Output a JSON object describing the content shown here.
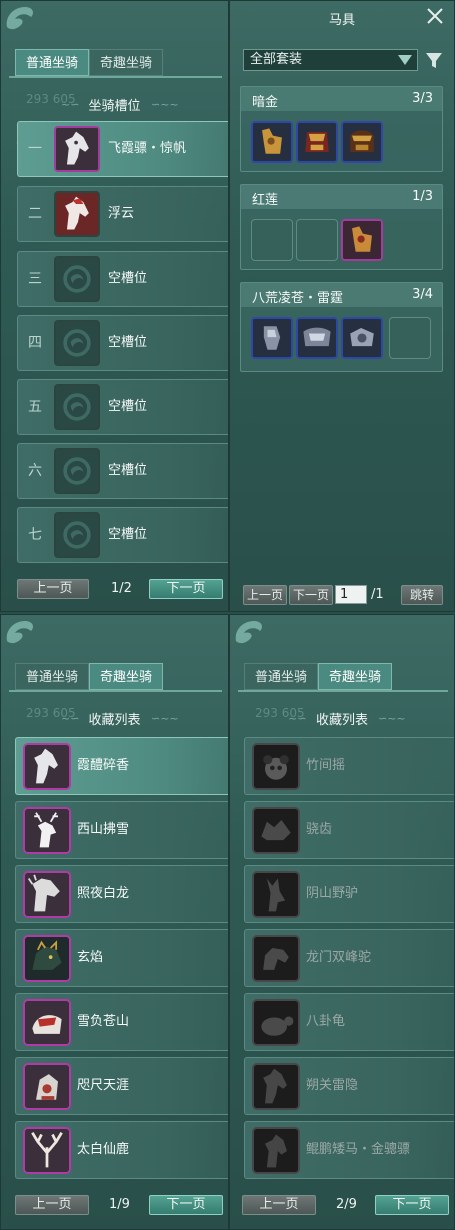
{
  "colors": {
    "panel_bg": "#2f5a54",
    "tab_active": "#4a8a80",
    "quality_purple": "#b23aa8",
    "quality_blue": "#2f48a8",
    "button_green": "#54a293",
    "button_gray": "#6e7775"
  },
  "tabs": {
    "normal": "普通坐骑",
    "fun": "奇趣坐骑"
  },
  "ghost_numbers": "293 605",
  "panel_slots": {
    "title": "坐骑槽位",
    "slots": [
      {
        "idx": "一",
        "name": "飞霞骠・惊帆",
        "icon": "white-horse-icon"
      },
      {
        "idx": "二",
        "name": "浮云",
        "icon": "red-horse-icon"
      },
      {
        "idx": "三",
        "name": "空槽位",
        "icon": "empty-slot-icon"
      },
      {
        "idx": "四",
        "name": "空槽位",
        "icon": "empty-slot-icon"
      },
      {
        "idx": "五",
        "name": "空槽位",
        "icon": "empty-slot-icon"
      },
      {
        "idx": "六",
        "name": "空槽位",
        "icon": "empty-slot-icon"
      },
      {
        "idx": "七",
        "name": "空槽位",
        "icon": "empty-slot-icon"
      }
    ],
    "prev": "上一页",
    "next": "下一页",
    "page": "1/2"
  },
  "panel_harness": {
    "title": "马具",
    "filter_value": "全部套装",
    "sets": [
      {
        "name": "暗金",
        "count": "3/3"
      },
      {
        "name": "红莲",
        "count": "1/3"
      },
      {
        "name": "八荒凌苍・雷霆",
        "count": "3/4"
      }
    ],
    "prev": "上一页",
    "next": "下一页",
    "page_input": "1",
    "page_total": "/1",
    "jump": "跳转"
  },
  "panel_collection_owned": {
    "title": "收藏列表",
    "items": [
      {
        "name": "霞醴碎香",
        "icon": "white-horse-icon"
      },
      {
        "name": "西山拂雪",
        "icon": "white-deer-icon"
      },
      {
        "name": "照夜白龙",
        "icon": "white-dragon-horse-icon"
      },
      {
        "name": "玄焰",
        "icon": "dark-beast-icon"
      },
      {
        "name": "雪负苍山",
        "icon": "armored-beast-icon"
      },
      {
        "name": "咫尺天涯",
        "icon": "mech-beast-icon"
      },
      {
        "name": "太白仙鹿",
        "icon": "antler-icon"
      }
    ],
    "prev": "上一页",
    "next": "下一页",
    "page": "1/9"
  },
  "panel_collection_locked": {
    "title": "收藏列表",
    "items": [
      {
        "name": "竹间摇",
        "icon": "panda-icon"
      },
      {
        "name": "骁齿",
        "icon": "wolf-icon"
      },
      {
        "name": "阴山野驴",
        "icon": "donkey-icon"
      },
      {
        "name": "龙门双峰驼",
        "icon": "camel-icon"
      },
      {
        "name": "八卦龟",
        "icon": "turtle-icon"
      },
      {
        "name": "朔关雷隐",
        "icon": "dark-horse-icon"
      },
      {
        "name": "鲲鹏矮马・金骢骠",
        "icon": "pony-icon"
      }
    ],
    "prev": "上一页",
    "next": "下一页",
    "page": "2/9"
  }
}
